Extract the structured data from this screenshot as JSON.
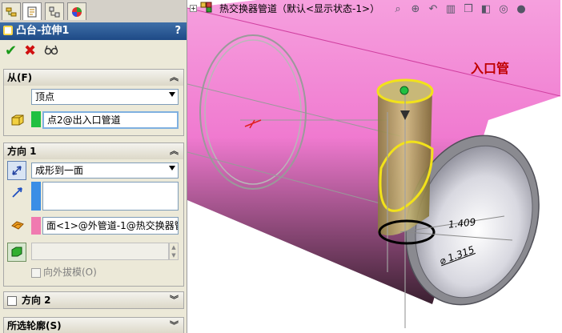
{
  "property_manager": {
    "title": "凸台-拉伸1",
    "help": "?",
    "actions": {
      "ok_icon": "check-icon",
      "cancel_icon": "x-icon",
      "preview_icon": "glasses-icon"
    },
    "from": {
      "header": "从(F)",
      "condition": "顶点",
      "vertex_value": "点2@出入口管道"
    },
    "direction1": {
      "header": "方向 1",
      "end_condition": "成形到一面",
      "direction_value": "",
      "face_value": "面<1>@外管道-1@热交换器管i",
      "depth_value": "",
      "draft_outward": "向外拔模(O)"
    },
    "direction2": {
      "header": "方向 2",
      "checked": false
    },
    "selected_contours": {
      "header": "所选轮廓(S)"
    }
  },
  "graphics": {
    "tree_title": "热交换器管道（默认<显示状态-1>）",
    "annotation": "入口管",
    "dim1": "1.409",
    "dim2": "⌀ 1.315"
  },
  "colors": {
    "pipe_pink": "#f07ad0",
    "title_blue": "#2b5a96",
    "highlight_yellow": "#f2e21a",
    "green_select": "#20c040",
    "blue_select": "#3a8ee6"
  }
}
